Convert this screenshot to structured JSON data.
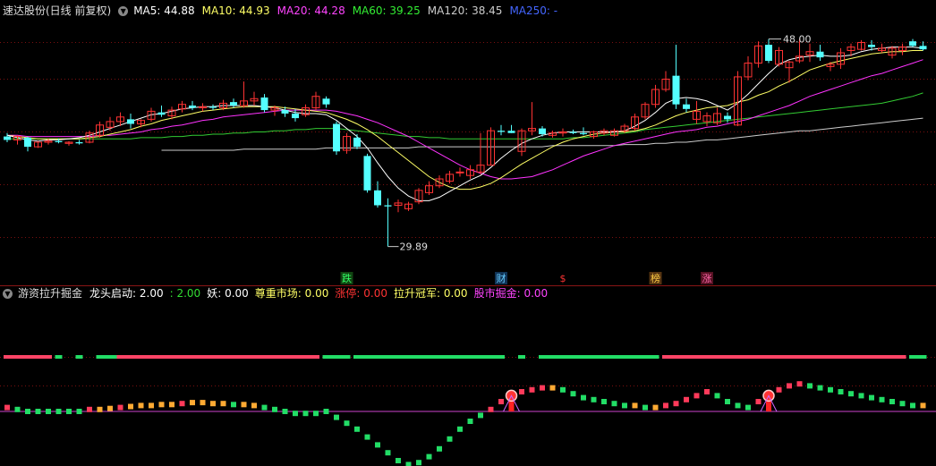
{
  "colors": {
    "up": "#ff3333",
    "down": "#54ffff",
    "ma5": "#ffffff",
    "ma10": "#ffff66",
    "ma20": "#ff33ff",
    "ma60": "#33cc33",
    "ma120": "#cccccc",
    "ma250": "#4444ff",
    "grid": "#7a1010",
    "baseline": "#cc44cc",
    "bar_red": "#ff3a5a",
    "bar_green": "#22dd66"
  },
  "top_panel": {
    "title": "速达股份(日线 前复权)",
    "indicators": [
      {
        "label": "MA5:",
        "value": "44.88",
        "color": "#ffffff"
      },
      {
        "label": "MA10:",
        "value": "44.93",
        "color": "#ffff66"
      },
      {
        "label": "MA20:",
        "value": "44.28",
        "color": "#ff44ff"
      },
      {
        "label": "MA60:",
        "value": "39.25",
        "color": "#33ee33"
      },
      {
        "label": "MA120:",
        "value": "38.45",
        "color": "#cccccc"
      },
      {
        "label": "MA250:",
        "value": "-",
        "color": "#4466ff"
      }
    ],
    "high_label": "48.00",
    "low_label": "29.89",
    "event_labels": [
      {
        "text": "跌",
        "color": "#33ff66",
        "bg": "#114411",
        "index": 33
      },
      {
        "text": "财",
        "color": "#66ccff",
        "bg": "#113355",
        "index": 48
      },
      {
        "text": "$",
        "color": "#ff3333",
        "bg": "",
        "index": 54
      },
      {
        "text": "榜",
        "color": "#ffcc44",
        "bg": "#553311",
        "index": 63
      },
      {
        "text": "涨",
        "color": "#ff66aa",
        "bg": "#551122",
        "index": 68
      }
    ]
  },
  "bottom_panel": {
    "title": "游资拉升掘金",
    "indicators": [
      {
        "label": "龙头启动:",
        "value": "2.00",
        "color": "#ffffff"
      },
      {
        "label": ":",
        "value": "2.00",
        "color": "#33dd33"
      },
      {
        "label": "妖:",
        "value": "0.00",
        "color": "#ffffff"
      },
      {
        "label": "尊重市场:",
        "value": "0.00",
        "color": "#ffff66"
      },
      {
        "label": "涨停:",
        "value": "0.00",
        "color": "#ff3333"
      },
      {
        "label": "拉升冠军:",
        "value": "0.00",
        "color": "#ffff66"
      },
      {
        "label": "股市掘金:",
        "value": "0.00",
        "color": "#ff44ff"
      }
    ]
  },
  "chart_data": {
    "type": "candlestick",
    "ylim": [
      28,
      50
    ],
    "candles": [
      [
        39.5,
        39.8,
        39.0,
        39.2
      ],
      [
        39.2,
        39.6,
        38.8,
        39.5
      ],
      [
        39.4,
        39.5,
        38.2,
        38.6
      ],
      [
        38.6,
        39.1,
        38.5,
        39.0
      ],
      [
        39.0,
        39.3,
        38.8,
        39.1
      ],
      [
        39.1,
        39.3,
        38.9,
        39.0
      ],
      [
        38.9,
        39.1,
        38.7,
        39.0
      ],
      [
        39.0,
        39.2,
        38.8,
        38.9
      ],
      [
        39.0,
        40.0,
        38.9,
        39.8
      ],
      [
        39.6,
        40.8,
        39.4,
        40.5
      ],
      [
        40.3,
        41.2,
        40.0,
        40.8
      ],
      [
        40.8,
        41.6,
        40.4,
        41.2
      ],
      [
        41.0,
        41.5,
        40.2,
        40.6
      ],
      [
        40.6,
        41.0,
        40.3,
        40.9
      ],
      [
        41.0,
        42.0,
        40.8,
        41.7
      ],
      [
        41.6,
        42.2,
        41.2,
        41.4
      ],
      [
        41.3,
        42.1,
        41.0,
        41.8
      ],
      [
        41.9,
        42.6,
        41.6,
        42.3
      ],
      [
        42.2,
        42.6,
        41.8,
        42.0
      ],
      [
        42.0,
        42.4,
        41.7,
        42.1
      ],
      [
        42.1,
        42.3,
        41.8,
        42.0
      ],
      [
        42.0,
        42.7,
        41.8,
        42.4
      ],
      [
        42.5,
        42.8,
        42.0,
        42.2
      ],
      [
        42.2,
        44.3,
        42.0,
        42.6
      ],
      [
        42.6,
        43.4,
        42.2,
        42.8
      ],
      [
        42.9,
        43.2,
        41.6,
        41.8
      ],
      [
        41.8,
        42.2,
        41.3,
        42.0
      ],
      [
        41.8,
        42.1,
        41.2,
        41.5
      ],
      [
        41.5,
        41.9,
        40.8,
        41.1
      ],
      [
        41.4,
        42.3,
        41.2,
        42.0
      ],
      [
        42.0,
        43.4,
        41.8,
        43.0
      ],
      [
        42.8,
        43.0,
        42.0,
        42.3
      ],
      [
        40.6,
        40.8,
        37.9,
        38.2
      ],
      [
        38.3,
        39.8,
        38.0,
        39.5
      ],
      [
        39.4,
        39.7,
        38.4,
        38.6
      ],
      [
        37.8,
        38.0,
        34.6,
        34.8
      ],
      [
        34.8,
        35.6,
        33.3,
        33.5
      ],
      [
        33.5,
        34.1,
        29.9,
        33.4
      ],
      [
        33.5,
        34.0,
        32.9,
        33.7
      ],
      [
        33.2,
        33.8,
        33.0,
        33.6
      ],
      [
        33.8,
        35.0,
        33.6,
        34.8
      ],
      [
        34.6,
        35.6,
        34.4,
        35.2
      ],
      [
        35.2,
        36.1,
        35.0,
        35.8
      ],
      [
        35.6,
        36.5,
        35.4,
        36.2
      ],
      [
        36.4,
        36.8,
        36.0,
        36.4
      ],
      [
        36.1,
        37.0,
        35.8,
        36.6
      ],
      [
        36.4,
        39.8,
        36.2,
        37.0
      ],
      [
        37.0,
        40.3,
        37.0,
        40.0
      ],
      [
        40.0,
        40.5,
        39.6,
        39.9
      ],
      [
        40.0,
        40.5,
        39.8,
        39.8
      ],
      [
        38.2,
        40.2,
        37.8,
        40.0
      ],
      [
        40.0,
        42.5,
        39.6,
        40.2
      ],
      [
        40.2,
        40.4,
        39.5,
        39.7
      ],
      [
        39.6,
        40.0,
        39.4,
        39.8
      ],
      [
        39.8,
        40.2,
        39.5,
        39.9
      ],
      [
        39.9,
        40.1,
        39.7,
        39.8
      ],
      [
        39.8,
        40.3,
        39.6,
        39.7
      ],
      [
        39.5,
        40.0,
        39.3,
        39.9
      ],
      [
        39.8,
        40.2,
        39.6,
        40.0
      ],
      [
        39.6,
        40.2,
        39.5,
        40.0
      ],
      [
        40.0,
        40.6,
        39.8,
        40.4
      ],
      [
        40.2,
        41.5,
        40.0,
        41.2
      ],
      [
        41.2,
        42.5,
        41.0,
        42.3
      ],
      [
        42.3,
        44.0,
        42.0,
        43.6
      ],
      [
        43.6,
        45.2,
        43.4,
        44.5
      ],
      [
        44.8,
        47.5,
        41.9,
        42.3
      ],
      [
        42.3,
        42.8,
        41.6,
        41.9
      ],
      [
        41.0,
        42.6,
        40.6,
        41.7
      ],
      [
        40.8,
        41.6,
        40.4,
        41.3
      ],
      [
        40.7,
        42.0,
        40.5,
        41.5
      ],
      [
        41.3,
        41.6,
        40.7,
        41.0
      ],
      [
        40.5,
        45.2,
        40.4,
        44.7
      ],
      [
        44.7,
        46.5,
        44.4,
        45.9
      ],
      [
        45.9,
        47.8,
        45.5,
        47.4
      ],
      [
        47.5,
        48.0,
        45.9,
        46.1
      ],
      [
        45.8,
        47.3,
        45.6,
        47.0
      ],
      [
        45.5,
        46.1,
        44.2,
        46.0
      ],
      [
        46.1,
        48.0,
        45.9,
        46.5
      ],
      [
        46.6,
        47.6,
        46.0,
        46.9
      ],
      [
        46.9,
        47.5,
        46.1,
        46.4
      ],
      [
        45.6,
        46.0,
        45.2,
        45.8
      ],
      [
        45.8,
        47.2,
        45.4,
        46.8
      ],
      [
        47.0,
        47.6,
        46.5,
        47.3
      ],
      [
        47.1,
        47.9,
        47.0,
        47.7
      ],
      [
        47.5,
        47.9,
        47.0,
        47.3
      ],
      [
        47.0,
        47.6,
        46.8,
        47.2
      ],
      [
        46.6,
        47.4,
        46.3,
        47.2
      ],
      [
        47.0,
        47.6,
        46.6,
        47.3
      ],
      [
        47.8,
        48.0,
        47.3,
        47.4
      ],
      [
        47.4,
        47.8,
        47.0,
        47.1
      ]
    ],
    "ma5": [
      39.6,
      39.4,
      39.2,
      39.1,
      39.2,
      39.2,
      39.3,
      39.4,
      39.6,
      39.9,
      40.2,
      40.5,
      40.8,
      41.1,
      41.4,
      41.5,
      41.7,
      41.9,
      42.0,
      42.1,
      42.1,
      42.2,
      42.2,
      42.2,
      42.2,
      42.1,
      42.0,
      41.8,
      41.6,
      41.5,
      41.5,
      41.4,
      40.9,
      40.2,
      39.5,
      38.5,
      37.2,
      36.0,
      35.0,
      34.3,
      33.9,
      33.9,
      34.2,
      34.7,
      35.2,
      35.7,
      36.1,
      36.8,
      37.6,
      38.3,
      38.9,
      39.3,
      39.6,
      39.8,
      39.9,
      39.9,
      39.9,
      39.9,
      39.9,
      39.9,
      40.0,
      40.4,
      40.9,
      41.6,
      42.4,
      42.8,
      42.9,
      42.8,
      42.6,
      42.2,
      41.8,
      42.4,
      43.2,
      44.1,
      45.0,
      45.8,
      46.2,
      46.4,
      46.5,
      46.6,
      46.5,
      46.5,
      46.6,
      46.9,
      47.1,
      47.2,
      47.3,
      47.3,
      47.3,
      47.2
    ],
    "ma10": [
      39.6,
      39.5,
      39.4,
      39.3,
      39.3,
      39.3,
      39.3,
      39.3,
      39.4,
      39.5,
      39.7,
      39.9,
      40.1,
      40.4,
      40.6,
      40.9,
      41.1,
      41.3,
      41.5,
      41.7,
      41.8,
      41.9,
      42.0,
      42.1,
      42.1,
      42.1,
      42.1,
      42.0,
      41.9,
      41.8,
      41.7,
      41.6,
      41.3,
      41.0,
      40.6,
      40.1,
      39.5,
      38.8,
      38.1,
      37.4,
      36.7,
      36.0,
      35.5,
      35.1,
      34.9,
      34.9,
      35.1,
      35.4,
      35.9,
      36.5,
      37.1,
      37.6,
      38.1,
      38.6,
      39.0,
      39.3,
      39.5,
      39.7,
      39.8,
      39.9,
      39.9,
      40.0,
      40.2,
      40.5,
      40.9,
      41.3,
      41.6,
      41.8,
      42.0,
      42.1,
      42.2,
      42.5,
      42.7,
      43.1,
      43.4,
      43.9,
      44.3,
      44.8,
      45.3,
      45.6,
      45.9,
      46.1,
      46.3,
      46.5,
      46.7,
      46.8,
      46.9,
      46.9,
      47.0,
      47.0
    ],
    "ma20": [
      39.6,
      39.6,
      39.5,
      39.5,
      39.5,
      39.5,
      39.5,
      39.5,
      39.5,
      39.6,
      39.6,
      39.7,
      39.8,
      39.9,
      40.1,
      40.2,
      40.4,
      40.5,
      40.7,
      40.9,
      41.0,
      41.2,
      41.3,
      41.4,
      41.5,
      41.6,
      41.7,
      41.8,
      41.8,
      41.8,
      41.8,
      41.8,
      41.7,
      41.5,
      41.3,
      41.0,
      40.7,
      40.3,
      39.9,
      39.5,
      39.0,
      38.5,
      38.0,
      37.5,
      37.0,
      36.6,
      36.3,
      36.0,
      35.8,
      35.8,
      35.9,
      36.0,
      36.3,
      36.6,
      37.0,
      37.4,
      37.8,
      38.1,
      38.4,
      38.7,
      38.9,
      39.1,
      39.3,
      39.5,
      39.7,
      39.9,
      40.0,
      40.1,
      40.3,
      40.4,
      40.6,
      40.8,
      41.0,
      41.3,
      41.6,
      41.9,
      42.2,
      42.6,
      43.0,
      43.3,
      43.6,
      43.9,
      44.2,
      44.5,
      44.8,
      45.0,
      45.3,
      45.6,
      45.9,
      46.2
    ],
    "ma60": [
      null,
      null,
      null,
      null,
      null,
      null,
      null,
      null,
      null,
      null,
      null,
      null,
      null,
      null,
      null,
      null,
      null,
      null,
      null,
      null,
      null,
      null,
      null,
      null,
      null,
      null,
      null,
      null,
      null,
      null,
      null,
      null,
      null,
      null,
      null,
      null,
      null,
      null,
      null,
      null,
      null,
      null,
      null,
      null,
      null,
      null,
      null,
      null,
      null,
      null,
      null,
      null,
      null,
      null,
      null,
      null,
      null,
      null,
      null,
      null,
      null,
      null,
      null,
      null,
      null,
      null,
      null,
      null,
      null,
      null,
      null,
      null,
      null,
      null,
      null,
      null,
      null,
      null,
      null,
      null,
      null,
      null,
      null,
      null,
      null,
      null,
      null,
      null,
      null,
      null
    ],
    "ma120": [
      null,
      null,
      null,
      null,
      null,
      null,
      null,
      null,
      null,
      null,
      null,
      null,
      null,
      null,
      null,
      38.3,
      38.3,
      38.3,
      38.3,
      38.3,
      38.3,
      38.3,
      38.3,
      38.4,
      38.4,
      38.4,
      38.4,
      38.4,
      38.4,
      38.4,
      38.4,
      38.5,
      38.5,
      38.5,
      38.5,
      38.5,
      38.5,
      38.5,
      38.5,
      38.5,
      38.6,
      38.6,
      38.6,
      38.6,
      38.6,
      38.6,
      38.6,
      38.6,
      38.6,
      38.6,
      38.6,
      38.6,
      38.6,
      38.7,
      38.7,
      38.7,
      38.7,
      38.7,
      38.7,
      38.7,
      38.8,
      38.8,
      38.8,
      38.9,
      38.9,
      39.0,
      39.0,
      39.1,
      39.2,
      39.2,
      39.3,
      39.4,
      39.5,
      39.6,
      39.7,
      39.8,
      39.9,
      40.0,
      40.0,
      40.1,
      40.2,
      40.3,
      40.4,
      40.5,
      40.6,
      40.7,
      40.8,
      40.9,
      41.0,
      41.1
    ],
    "ma60_vals": [
      39.3,
      39.3,
      39.3,
      39.3,
      39.3,
      39.3,
      39.3,
      39.3,
      39.3,
      39.3,
      39.3,
      39.3,
      39.3,
      39.4,
      39.4,
      39.4,
      39.5,
      39.5,
      39.6,
      39.6,
      39.7,
      39.7,
      39.8,
      39.8,
      39.9,
      39.9,
      40.0,
      40.0,
      40.1,
      40.1,
      40.2,
      40.2,
      40.2,
      40.1,
      40.0,
      39.9,
      39.8,
      39.7,
      39.6,
      39.5,
      39.5,
      39.4,
      39.4,
      39.3,
      39.3,
      39.3,
      39.3,
      39.3,
      39.3,
      39.3,
      39.3,
      39.3,
      39.3,
      39.3,
      39.3,
      39.4,
      39.4,
      39.5,
      39.6,
      39.7,
      39.8,
      39.9,
      40.1,
      40.2,
      40.3,
      40.4,
      40.5,
      40.6,
      40.7,
      40.8,
      40.9,
      41.0,
      41.1,
      41.2,
      41.3,
      41.4,
      41.5,
      41.6,
      41.7,
      41.8,
      41.9,
      42.0,
      42.1,
      42.2,
      42.3,
      42.4,
      42.6,
      42.8,
      43.0,
      43.3
    ],
    "osc": [
      0.2,
      0.1,
      0.0,
      0.0,
      0.0,
      0.0,
      0.0,
      0.0,
      0.1,
      0.1,
      0.15,
      0.2,
      0.25,
      0.3,
      0.3,
      0.35,
      0.35,
      0.4,
      0.45,
      0.45,
      0.4,
      0.4,
      0.35,
      0.35,
      0.3,
      0.2,
      0.1,
      0.0,
      -0.1,
      -0.1,
      -0.1,
      0.0,
      -0.3,
      -0.6,
      -0.9,
      -1.3,
      -1.7,
      -2.1,
      -2.5,
      -2.7,
      -2.6,
      -2.3,
      -1.9,
      -1.4,
      -0.9,
      -0.5,
      -0.2,
      0.1,
      0.5,
      0.8,
      1.0,
      1.1,
      1.2,
      1.2,
      1.1,
      0.9,
      0.7,
      0.6,
      0.5,
      0.4,
      0.3,
      0.3,
      0.2,
      0.2,
      0.3,
      0.4,
      0.6,
      0.8,
      1.0,
      0.8,
      0.5,
      0.3,
      0.2,
      0.5,
      0.8,
      1.1,
      1.3,
      1.4,
      1.3,
      1.2,
      1.1,
      1.0,
      0.9,
      0.8,
      0.7,
      0.6,
      0.5,
      0.4,
      0.3,
      0.3
    ],
    "osc_signals": [
      49,
      74
    ],
    "band": [
      [
        0,
        4,
        "#ff4466"
      ],
      [
        5,
        5,
        "#22dd66"
      ],
      [
        7,
        7,
        "#22dd66"
      ],
      [
        9,
        20,
        "#22dd66"
      ],
      [
        11,
        30,
        "#ff4466"
      ],
      [
        31,
        33,
        "#22dd66"
      ],
      [
        34,
        48,
        "#22dd66"
      ],
      [
        50,
        50,
        "#22dd66"
      ],
      [
        52,
        63,
        "#22dd66"
      ],
      [
        64,
        87,
        "#ff4466"
      ],
      [
        88,
        89,
        "#22dd66"
      ]
    ]
  }
}
